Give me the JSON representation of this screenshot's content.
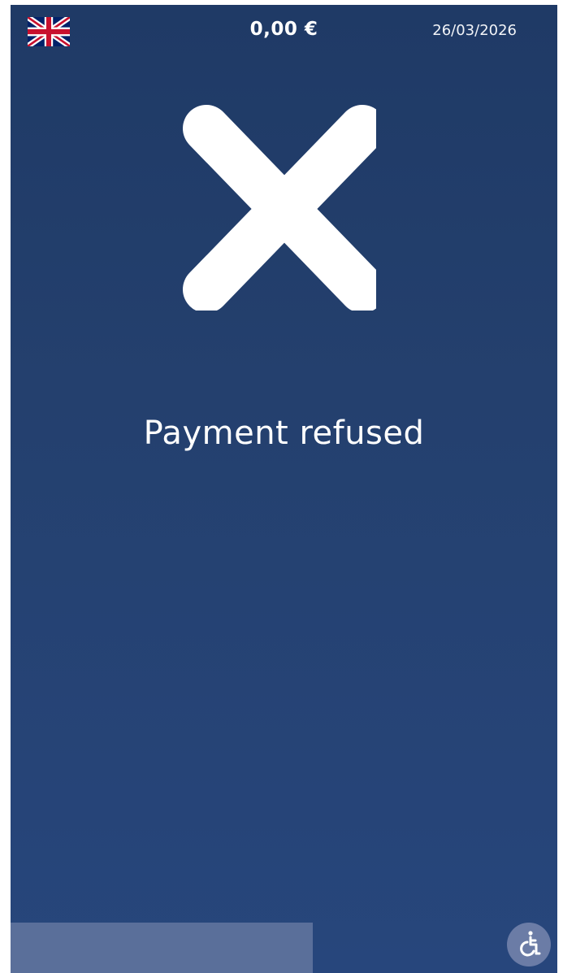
{
  "header": {
    "language_flag_icon": "uk-flag-icon",
    "amount": "0,00 €",
    "date": "26/03/2026"
  },
  "status": {
    "icon": "close-icon",
    "message": "Payment refused"
  },
  "progress": {
    "fraction": 0.553
  },
  "accessibility": {
    "icon": "accessibility-icon"
  },
  "colors": {
    "background_top": "#1f3a66",
    "background_bottom": "#27467c",
    "progress_fill": "#5a6f9a",
    "accessibility_button": "#6b7ca6"
  }
}
